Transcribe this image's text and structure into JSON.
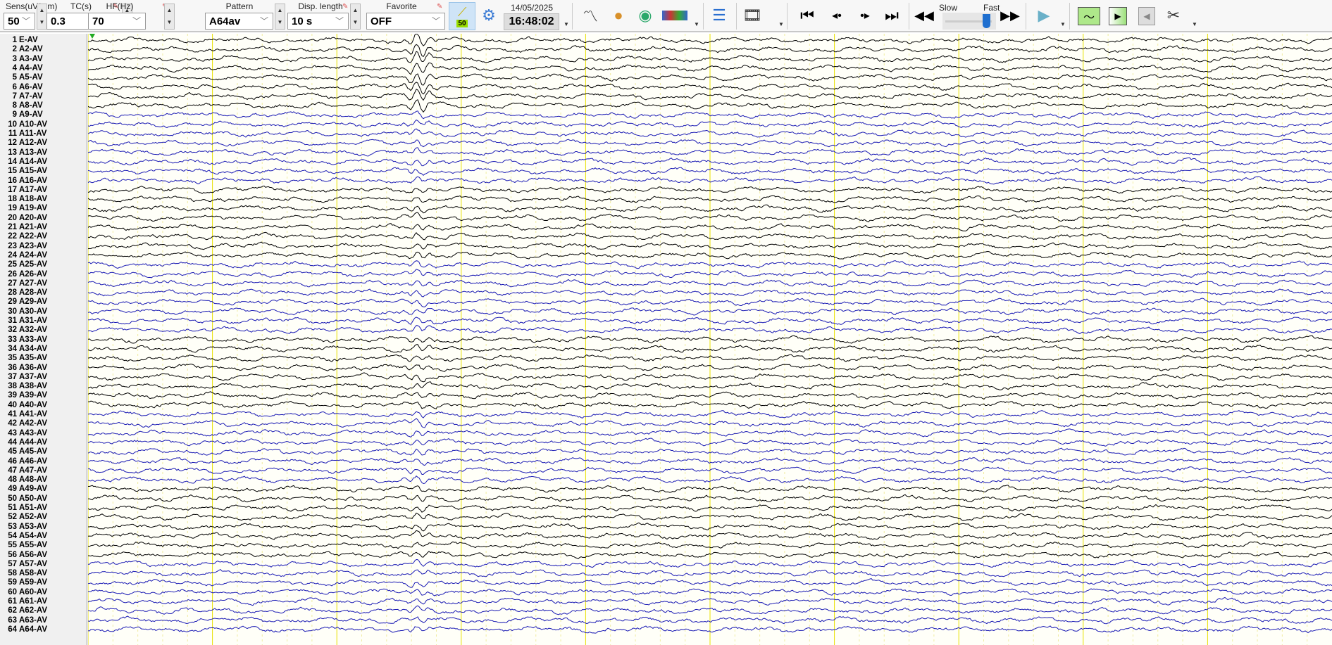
{
  "toolbar": {
    "sens": {
      "label": "Sens(uV/mm)",
      "value": "50"
    },
    "tc": {
      "label": "TC(s)",
      "value": "0.3"
    },
    "hf": {
      "label": "HF(Hz)",
      "value": "70"
    },
    "pattern": {
      "label": "Pattern",
      "value": "A64av"
    },
    "disp_length": {
      "label": "Disp. length",
      "value": "10 s"
    },
    "favorite": {
      "label": "Favorite",
      "value": "OFF"
    },
    "sens_badge": "50",
    "date": "14/05/2025",
    "time": "16:48:02",
    "speed_slow": "Slow",
    "speed_fast": "Fast",
    "speed_value": 0.85
  },
  "channels": [
    "E-AV",
    "A2-AV",
    "A3-AV",
    "A4-AV",
    "A5-AV",
    "A6-AV",
    "A7-AV",
    "A8-AV",
    "A9-AV",
    "A10-AV",
    "A11-AV",
    "A12-AV",
    "A13-AV",
    "A14-AV",
    "A15-AV",
    "A16-AV",
    "A17-AV",
    "A18-AV",
    "A19-AV",
    "A20-AV",
    "A21-AV",
    "A22-AV",
    "A23-AV",
    "A24-AV",
    "A25-AV",
    "A26-AV",
    "A27-AV",
    "A28-AV",
    "A29-AV",
    "A30-AV",
    "A31-AV",
    "A32-AV",
    "A33-AV",
    "A34-AV",
    "A35-AV",
    "A36-AV",
    "A37-AV",
    "A38-AV",
    "A39-AV",
    "A40-AV",
    "A41-AV",
    "A42-AV",
    "A43-AV",
    "A44-AV",
    "A45-AV",
    "A46-AV",
    "A47-AV",
    "A48-AV",
    "A49-AV",
    "A50-AV",
    "A51-AV",
    "A52-AV",
    "A53-AV",
    "A54-AV",
    "A55-AV",
    "A56-AV",
    "A57-AV",
    "A58-AV",
    "A59-AV",
    "A60-AV",
    "A61-AV",
    "A62-AV",
    "A63-AV",
    "A64-AV"
  ],
  "colors": {
    "group_a": "#000000",
    "group_b": "#1a1ab4",
    "grid_major": "#e8e000",
    "grid_minor": "#f0eca0"
  },
  "display_seconds": 10
}
